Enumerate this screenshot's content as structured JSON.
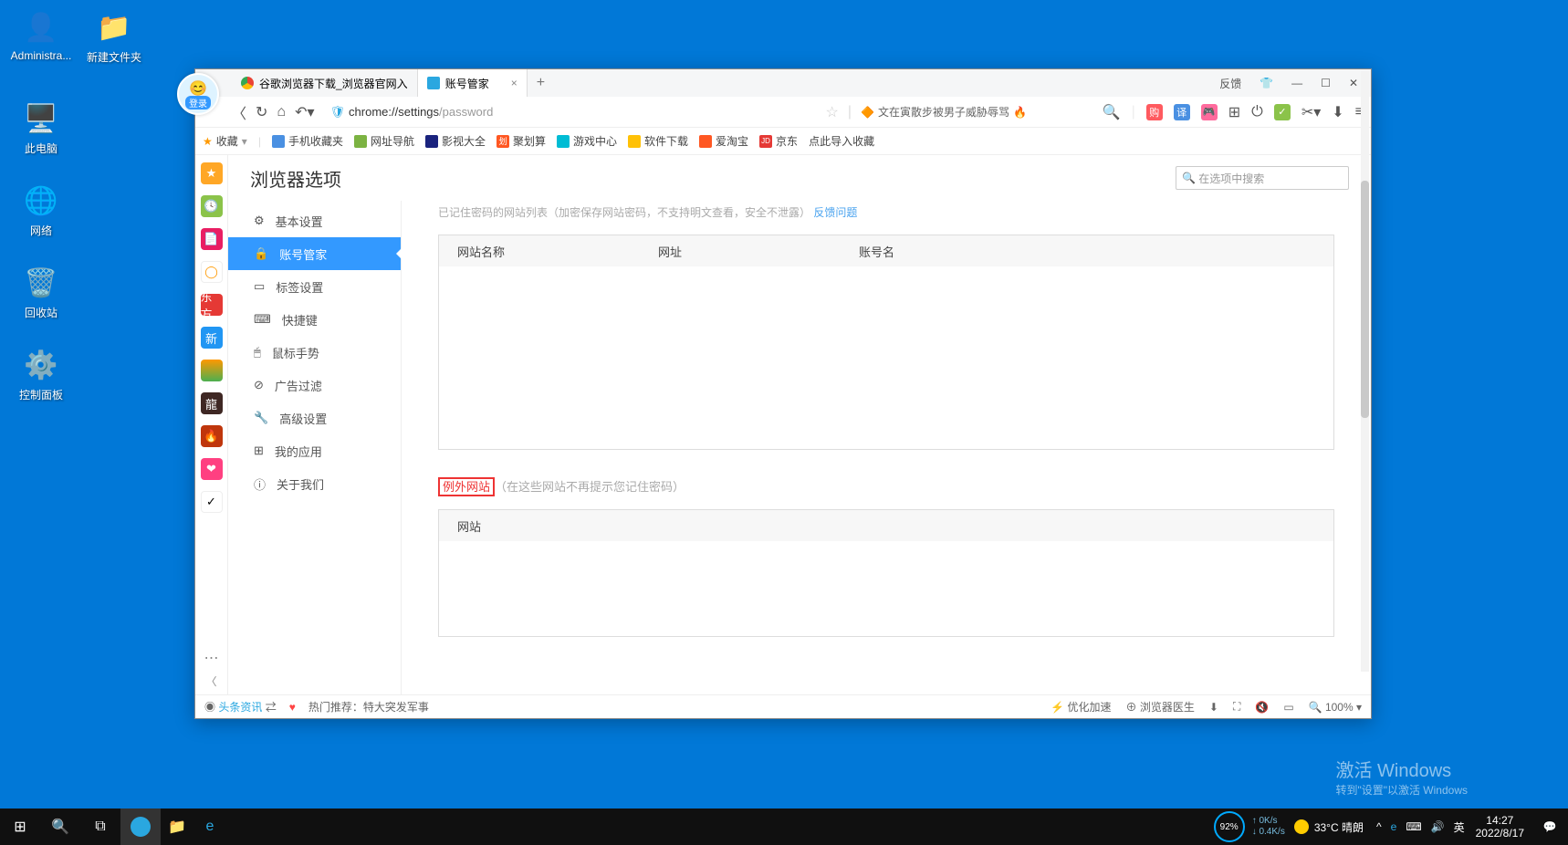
{
  "desktop": {
    "icons": [
      {
        "label": "Administra...",
        "glyph": "👤"
      },
      {
        "label": "新建文件夹",
        "glyph": "📁"
      },
      {
        "label": "此电脑",
        "glyph": "🖥️"
      },
      {
        "label": "网络",
        "glyph": "🌐"
      },
      {
        "label": "回收站",
        "glyph": "🗑️"
      },
      {
        "label": "控制面板",
        "glyph": "⚙️"
      }
    ]
  },
  "browser": {
    "login_label": "登录",
    "feedback_label": "反馈",
    "tabs": [
      {
        "title": "谷歌浏览器下载_浏览器官网入"
      },
      {
        "title": "账号管家"
      }
    ],
    "url": {
      "scheme": "chrome://",
      "path": "settings",
      "sub": "/password"
    },
    "addr_news": "文在寅散步被男子威胁辱骂",
    "bookmarks": {
      "fav": "收藏",
      "items": [
        "手机收藏夹",
        "网址导航",
        "影视大全",
        "聚划算",
        "游戏中心",
        "软件下载",
        "爱淘宝",
        "京东",
        "点此导入收藏"
      ]
    },
    "settings": {
      "title": "浏览器选项",
      "search_placeholder": "在选项中搜索",
      "nav": [
        "基本设置",
        "账号管家",
        "标签设置",
        "快捷键",
        "鼠标手势",
        "广告过滤",
        "高级设置",
        "我的应用",
        "关于我们"
      ],
      "cut_line": {
        "grey1": "已记住密码的网站列表（加密保存网站密码，不支持明文查看，安全不泄露）",
        "link": "反馈问题"
      },
      "table1": {
        "cols": [
          "网站名称",
          "网址",
          "账号名"
        ]
      },
      "section2": {
        "title": "例外网站",
        "note": "（在这些网站不再提示您记住密码）",
        "col": "网站"
      }
    },
    "status": {
      "news": "头条资讯",
      "hot": "热门推荐：特大突发军事",
      "opt": "优化加速",
      "doctor": "浏览器医生",
      "zoom": "100%"
    }
  },
  "taskbar": {
    "cpu": "92%",
    "net_up": "0K/s",
    "net_down": "0.4K/s",
    "temp": "33°C 晴朗",
    "ime": "英",
    "time": "14:27",
    "date": "2022/8/17"
  },
  "watermark": {
    "l1": "激活 Windows",
    "l2": "转到\"设置\"以激活 Windows"
  }
}
